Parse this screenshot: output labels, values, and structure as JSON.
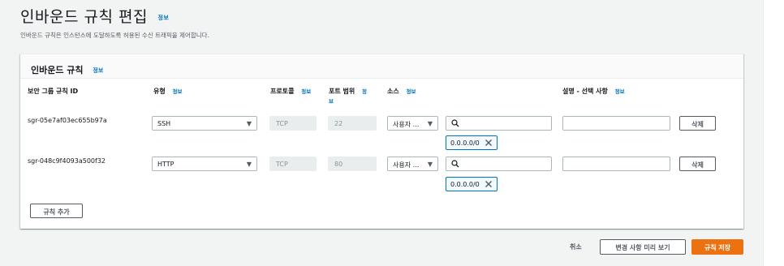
{
  "header": {
    "title": "인바운드 규칙 편집",
    "title_info": "정보",
    "subtitle": "인바운드 규칙은 인스턴스에 도달하도록 허용된 수신 트래픽을 제어합니다."
  },
  "panel": {
    "title": "인바운드 규칙",
    "title_info": "정보",
    "columns": {
      "rule_id": "보안 그룹 규칙 ID",
      "type": "유형",
      "type_info": "정보",
      "protocol": "프로토콜",
      "protocol_info": "정보",
      "port_range": "포트 범위",
      "port_range_info_1": "정",
      "port_range_info_2": "보",
      "source": "소스",
      "source_info": "정보",
      "description": "설명 - 선택 사항",
      "description_info": "정보"
    },
    "rows": [
      {
        "id": "sgr-05e7af03ec655b97a",
        "type": "SSH",
        "protocol": "TCP",
        "port": "22",
        "source_type": "사용자 ...",
        "source_search": "",
        "token": "0.0.0.0/0",
        "description": "",
        "delete_label": "삭제"
      },
      {
        "id": "sgr-048c9f4093a500f32",
        "type": "HTTP",
        "protocol": "TCP",
        "port": "80",
        "source_type": "사용자 ...",
        "source_search": "",
        "token": "0.0.0.0/0",
        "description": "",
        "delete_label": "삭제"
      }
    ],
    "add_rule_label": "규칙 추가"
  },
  "footer": {
    "cancel_label": "취소",
    "preview_label": "변경 사항 미리 보기",
    "save_label": "규칙 저장"
  },
  "colors": {
    "primary_button": "#ec7211",
    "info_link": "#0073bb",
    "token_border": "#0073bb"
  }
}
